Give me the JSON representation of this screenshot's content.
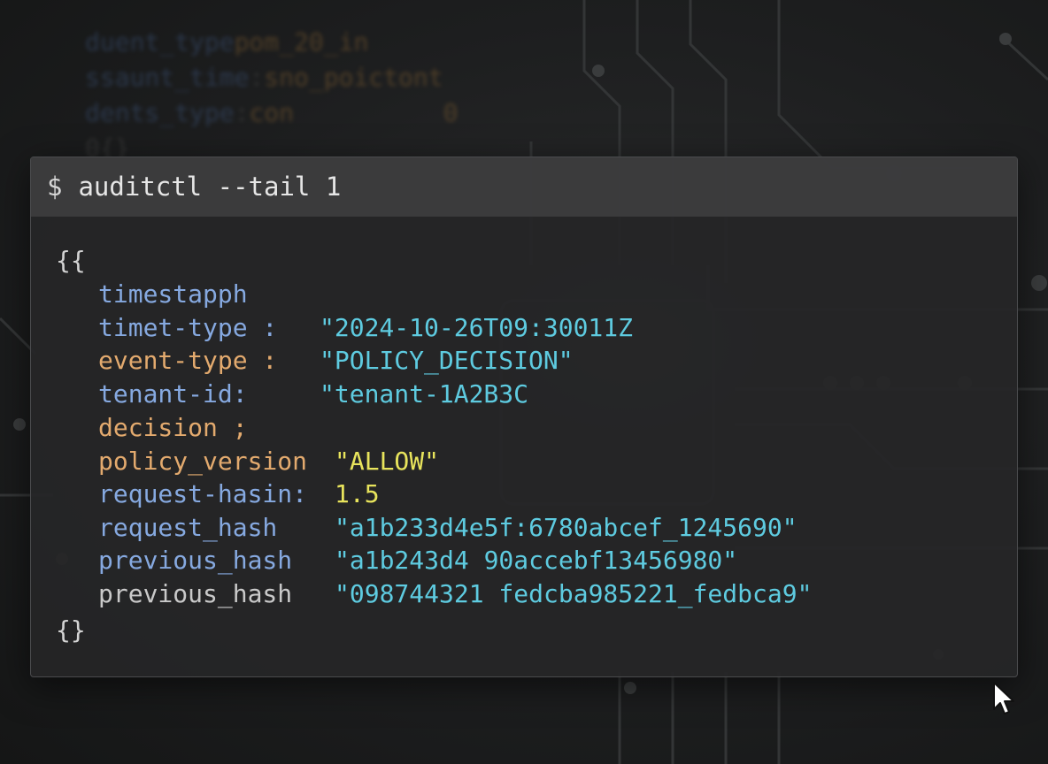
{
  "background": {
    "text_lines": [
      {
        "key": "duent_type",
        "value": "pom_20_in"
      },
      {
        "key": "ssaunt_time",
        "value": "sno_poictont"
      },
      {
        "key": "dents_type",
        "value": "con",
        "extra": "0"
      },
      {
        "key": "0{}",
        "value": ""
      }
    ]
  },
  "terminal": {
    "prompt": "$",
    "command": "auditctl --tail 1",
    "open_brace": "{{",
    "close_brace": "{}",
    "lines": [
      {
        "key": "timestapph",
        "sep": "",
        "value": ""
      },
      {
        "key": "timet-type",
        "sep": " :",
        "value": "\"2024-10-26T09:30011Z"
      },
      {
        "key": "event-type",
        "sep": " :",
        "value": "\"POLICY_DECISION\""
      },
      {
        "key": "tenant-id:",
        "sep": "",
        "value": "\"tenant-1A2B3C"
      },
      {
        "key": "decision",
        "sep": " ;",
        "value": ""
      },
      {
        "key": "policy_version",
        "sep": "",
        "value": "\"ALLOW\""
      },
      {
        "key": "request-hasin:",
        "sep": "",
        "value": "1.5"
      },
      {
        "key": "request_hash",
        "sep": "",
        "value": "\"a1b233d4e5f:6780abcef_1245690\""
      },
      {
        "key": "previous_hash",
        "sep": "",
        "value": "\"a1b243d4 90accebf13456980\""
      },
      {
        "key": "previous_hash",
        "sep": "",
        "value": "\"098744321 fedcba985221_fedbca9\""
      }
    ]
  },
  "colors": {
    "key_blue": "#86a9e0",
    "key_orange": "#e3aa6e",
    "value_cyan": "#5ecbe0",
    "value_yellow": "#e8e45c"
  },
  "icons": [
    "mouse-cursor-icon"
  ]
}
